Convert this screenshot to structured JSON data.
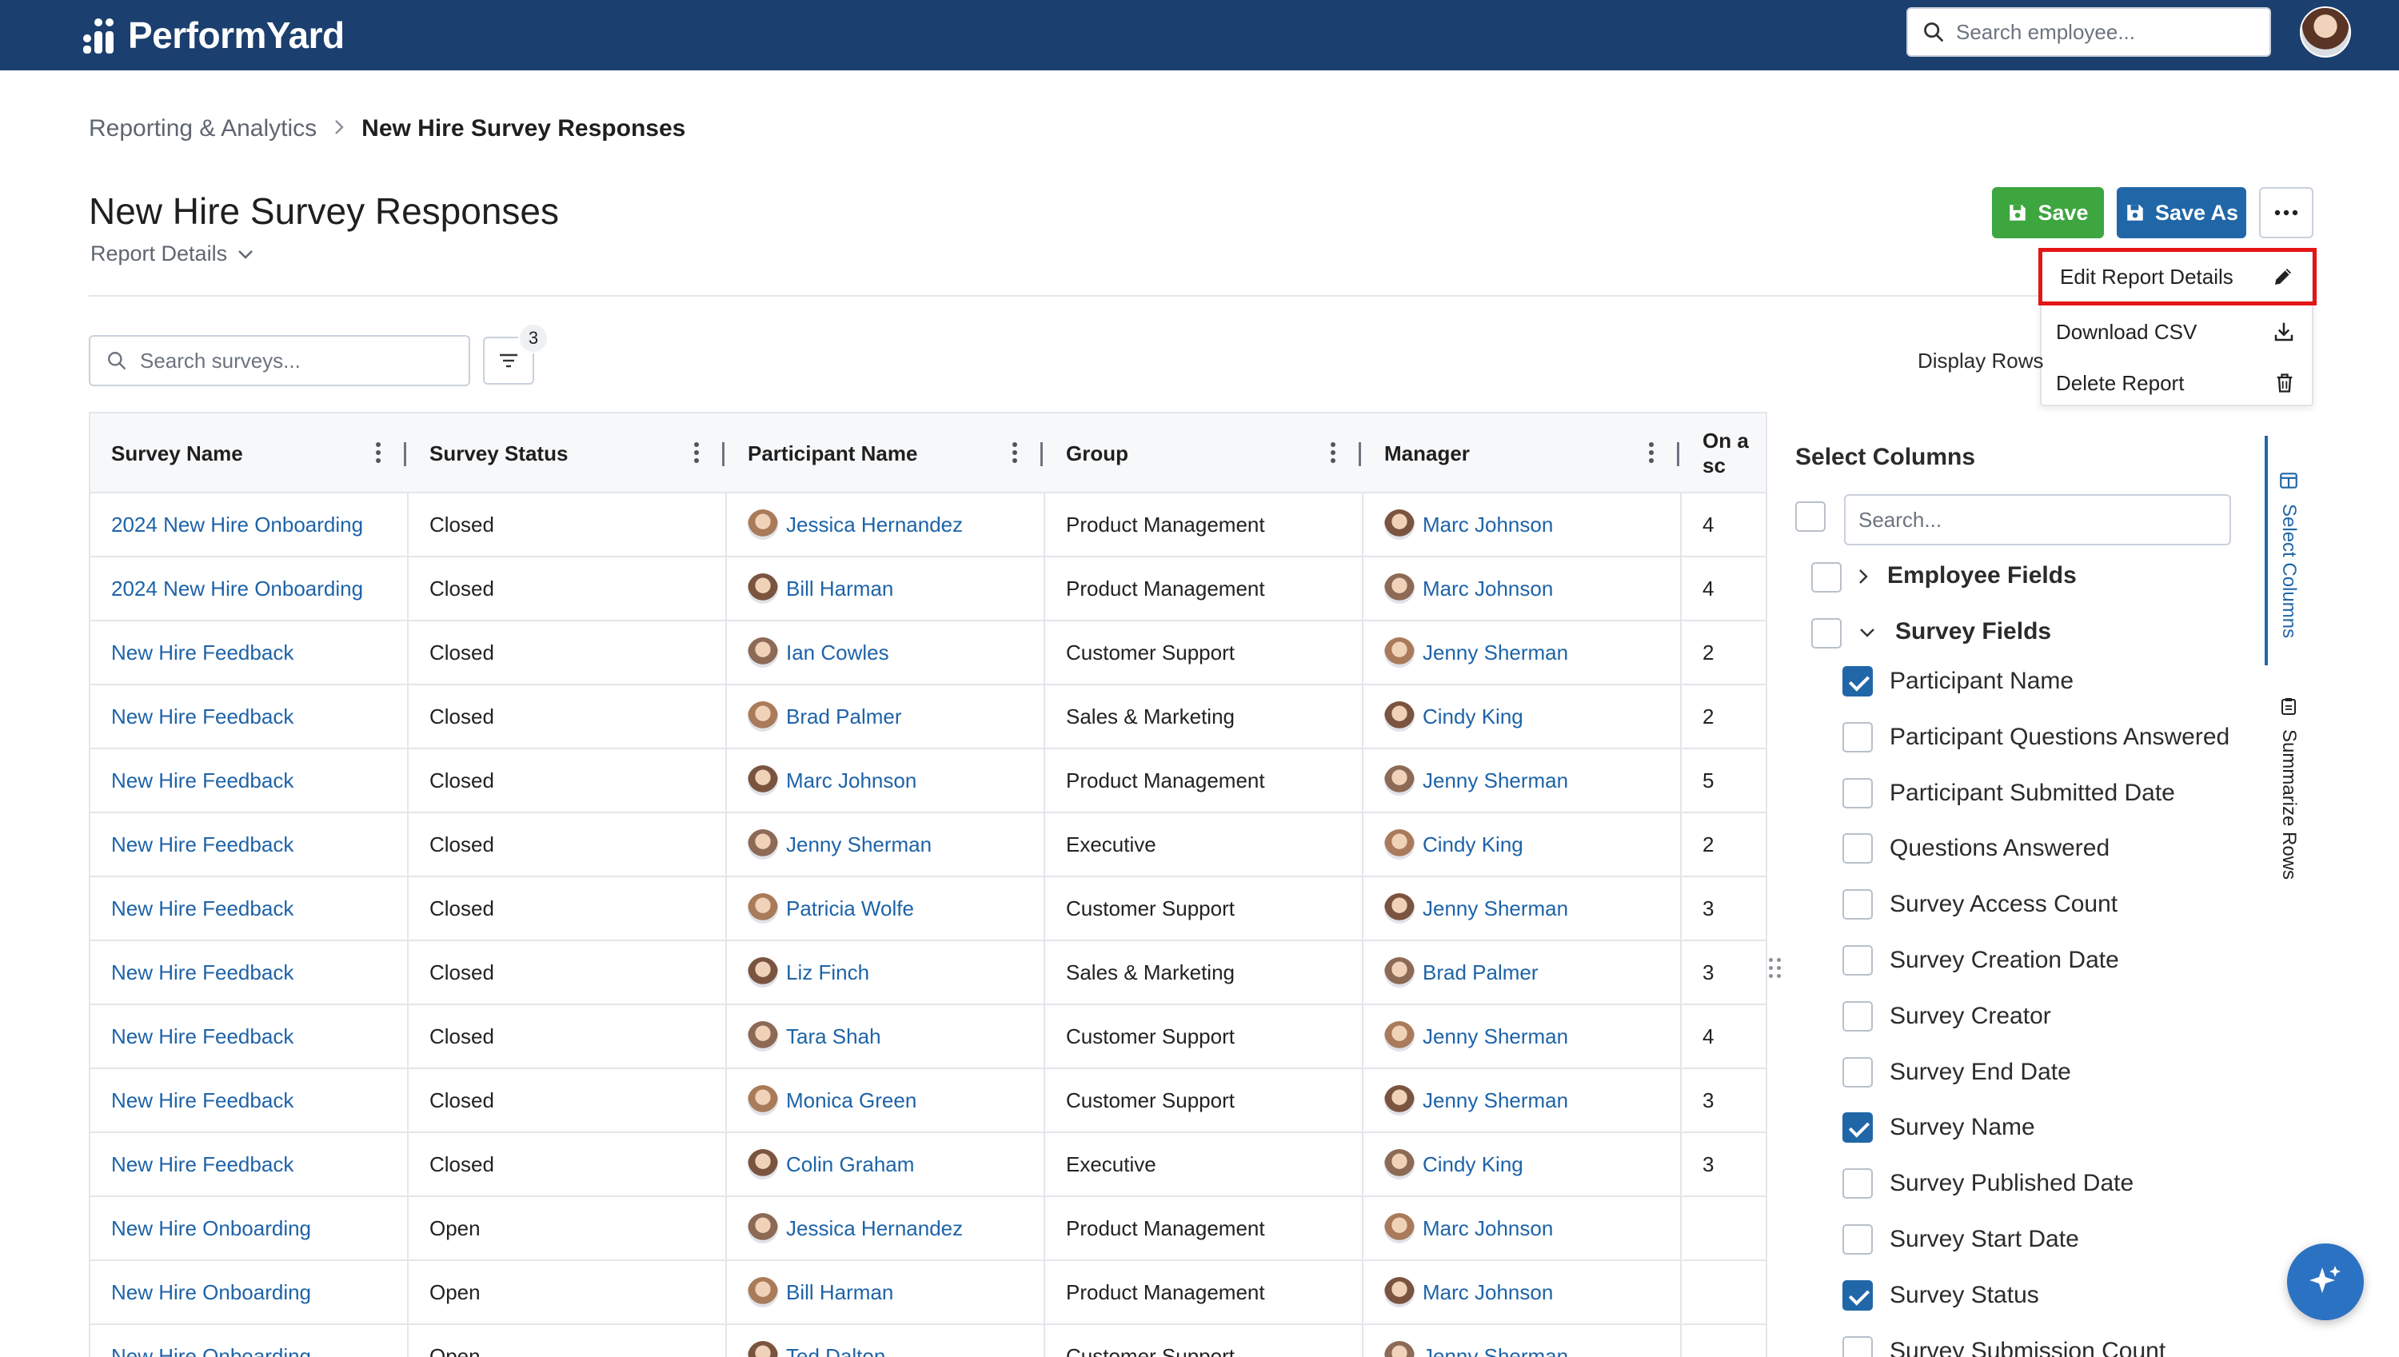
{
  "app": {
    "brand": "PerformYard"
  },
  "header": {
    "search_placeholder": "Search employee..."
  },
  "breadcrumb": {
    "parent": "Reporting & Analytics",
    "separator": ">",
    "current": "New Hire Survey Responses"
  },
  "page": {
    "title": "New Hire Survey Responses",
    "report_details": "Report Details"
  },
  "actions": {
    "save": "Save",
    "save_as": "Save As",
    "more": "•••"
  },
  "menu": {
    "items": [
      {
        "label": "Edit Report Details",
        "icon": "pencil-icon"
      },
      {
        "label": "Download CSV",
        "icon": "download-icon"
      },
      {
        "label": "Delete Report",
        "icon": "trash-icon"
      }
    ]
  },
  "toolbar": {
    "search_placeholder": "Search surveys...",
    "filter_count": "3",
    "display_rows": "Display Rows"
  },
  "table": {
    "columns": [
      "Survey Name",
      "Survey Status",
      "Participant Name",
      "Group",
      "Manager",
      "On a sc"
    ],
    "rows": [
      [
        "2024 New Hire Onboarding",
        "Closed",
        "Jessica Hernandez",
        "Product Management",
        "Marc Johnson",
        "4"
      ],
      [
        "2024 New Hire Onboarding",
        "Closed",
        "Bill Harman",
        "Product Management",
        "Marc Johnson",
        "4"
      ],
      [
        "New Hire Feedback",
        "Closed",
        "Ian Cowles",
        "Customer Support",
        "Jenny Sherman",
        "2"
      ],
      [
        "New Hire Feedback",
        "Closed",
        "Brad Palmer",
        "Sales & Marketing",
        "Cindy King",
        "2"
      ],
      [
        "New Hire Feedback",
        "Closed",
        "Marc Johnson",
        "Product Management",
        "Jenny Sherman",
        "5"
      ],
      [
        "New Hire Feedback",
        "Closed",
        "Jenny Sherman",
        "Executive",
        "Cindy King",
        "2"
      ],
      [
        "New Hire Feedback",
        "Closed",
        "Patricia Wolfe",
        "Customer Support",
        "Jenny Sherman",
        "3"
      ],
      [
        "New Hire Feedback",
        "Closed",
        "Liz Finch",
        "Sales & Marketing",
        "Brad Palmer",
        "3"
      ],
      [
        "New Hire Feedback",
        "Closed",
        "Tara Shah",
        "Customer Support",
        "Jenny Sherman",
        "4"
      ],
      [
        "New Hire Feedback",
        "Closed",
        "Monica Green",
        "Customer Support",
        "Jenny Sherman",
        "3"
      ],
      [
        "New Hire Feedback",
        "Closed",
        "Colin Graham",
        "Executive",
        "Cindy King",
        "3"
      ],
      [
        "New Hire Onboarding",
        "Open",
        "Jessica Hernandez",
        "Product Management",
        "Marc Johnson",
        ""
      ],
      [
        "New Hire Onboarding",
        "Open",
        "Bill Harman",
        "Product Management",
        "Marc Johnson",
        ""
      ],
      [
        "New Hire Onboarding",
        "Open",
        "Ted Dalton",
        "Customer Support",
        "Jenny Sherman",
        ""
      ]
    ]
  },
  "select_columns": {
    "title": "Select Columns",
    "search_placeholder": "Search...",
    "groups": [
      {
        "label": "Employee Fields",
        "expanded": false
      },
      {
        "label": "Survey Fields",
        "expanded": true
      }
    ],
    "fields": [
      {
        "label": "Participant Name",
        "checked": true
      },
      {
        "label": "Participant Questions Answered",
        "checked": false
      },
      {
        "label": "Participant Submitted Date",
        "checked": false
      },
      {
        "label": "Questions Answered",
        "checked": false
      },
      {
        "label": "Survey Access Count",
        "checked": false
      },
      {
        "label": "Survey Creation Date",
        "checked": false
      },
      {
        "label": "Survey Creator",
        "checked": false
      },
      {
        "label": "Survey End Date",
        "checked": false
      },
      {
        "label": "Survey Name",
        "checked": true
      },
      {
        "label": "Survey Published Date",
        "checked": false
      },
      {
        "label": "Survey Start Date",
        "checked": false
      },
      {
        "label": "Survey Status",
        "checked": true
      },
      {
        "label": "Survey Submission Count",
        "checked": false
      }
    ]
  },
  "side_tabs": {
    "select_columns": "Select Columns",
    "summarize_rows": "Summarize Rows"
  },
  "colors": {
    "header_bg": "#1b3f6e",
    "save": "#3da63f",
    "save_as": "#2167a8",
    "link": "#1d63a8",
    "highlight": "#e31515"
  }
}
